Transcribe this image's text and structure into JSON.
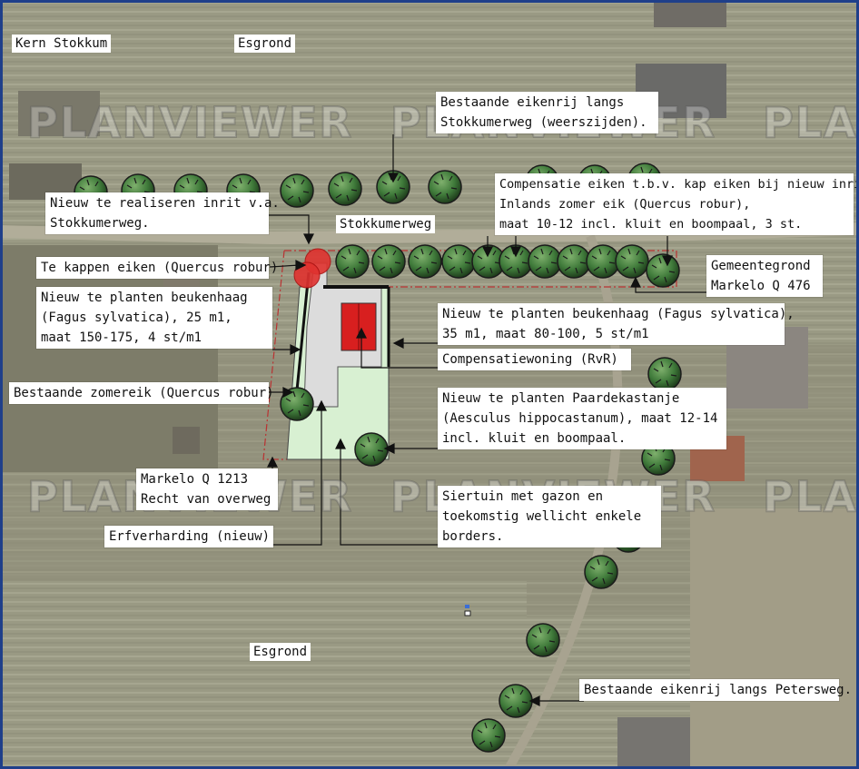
{
  "places": {
    "kern_stokkum": "Kern Stokkum",
    "esgrond_top": "Esgrond",
    "esgrond_bottom": "Esgrond",
    "stokkumerweg": "Stokkumerweg"
  },
  "watermark": "PLANVIEWER",
  "labels": {
    "eikenrij_stokkumerweg": "Bestaande eikenrij langs\nStokkumerweg (weerszijden).",
    "compensatie_eiken": "Compensatie eiken t.b.v. kap eiken bij nieuw inrit.\nInlands zomer eik (Quercus robur),\nmaat 10-12 incl. kluit en boompaal, 3 st.",
    "nieuw_inrit": "Nieuw te realiseren inrit v.a.\nStokkumerweg.",
    "te_kappen": "Te kappen eiken (Quercus robur)",
    "beukenhaag_links": "Nieuw te planten beukenhaag\n(Fagus sylvatica), 25 m1,\nmaat 150-175, 4 st/m1",
    "gemeentegrond": "Gemeentegrond\nMarkelo Q 476",
    "beukenhaag_rechts": "Nieuw te planten beukenhaag (Fagus sylvatica),\n35 m1, maat 80-100, 5 st/m1",
    "compensatiewoning": "Compensatiewoning (RvR)",
    "zomereik": "Bestaande zomereik (Quercus robur)",
    "paardekastanje": "Nieuw te planten Paardekastanje\n(Aesculus hippocastanum), maat 12-14\nincl. kluit en boompaal.",
    "markelo_1213": "Markelo Q 1213\nRecht van overweg",
    "siertuin": "Siertuin met gazon en\ntoekomstig wellicht enkele\nborders.",
    "erfverharding": "Erfverharding (nieuw)",
    "eikenrij_petersweg": "Bestaande eikenrij langs Petersweg."
  },
  "colors": {
    "map_background": "#8f8f7c",
    "tree_fill": "#3f7a3a",
    "cut_tree": "#e0322f",
    "house": "#d81f1f",
    "garden": "#d8f0d2",
    "paving": "#dcdcdc",
    "frame": "#1f3f8a"
  },
  "icons": {
    "tree": "tree-icon",
    "cut_tree": "cut-tree-icon",
    "house": "house-icon",
    "marker": "map-marker-icon"
  }
}
